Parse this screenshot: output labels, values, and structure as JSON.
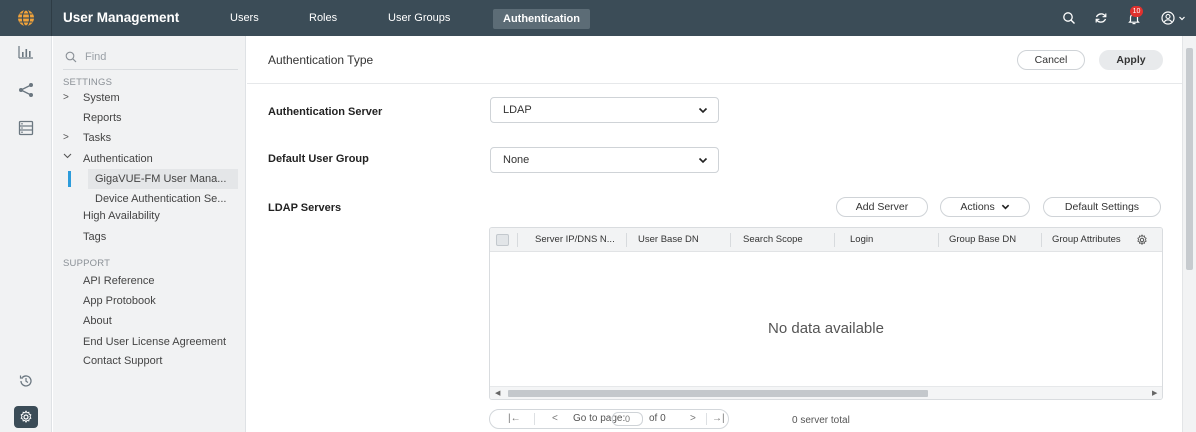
{
  "topbar": {
    "app_title": "User Management",
    "tabs": [
      {
        "label": "Users",
        "active": false
      },
      {
        "label": "Roles",
        "active": false
      },
      {
        "label": "User Groups",
        "active": false
      },
      {
        "label": "Authentication",
        "active": true
      }
    ],
    "notification_count": "10",
    "icons": [
      "globe-icon",
      "search-icon",
      "refresh-icon",
      "bell-icon",
      "user-icon"
    ]
  },
  "rail": {
    "icons": [
      "bar-chart-icon",
      "share-icon",
      "server-icon",
      "history-icon",
      "gear-icon"
    ]
  },
  "sidebar": {
    "search_placeholder": "Find",
    "settings_label": "SETTINGS",
    "support_label": "SUPPORT",
    "settings_items": [
      {
        "label": "System",
        "chevron": ">"
      },
      {
        "label": "Reports",
        "chevron": ""
      },
      {
        "label": "Tasks",
        "chevron": ">"
      },
      {
        "label": "Authentication",
        "chevron": "v"
      }
    ],
    "auth_children": [
      "GigaVUE-FM User Mana...",
      "Device Authentication Se..."
    ],
    "more_items": [
      "High Availability",
      "Tags"
    ],
    "support_items": [
      "API Reference",
      "App Protobook",
      "About",
      "End User License Agreement",
      "Contact Support"
    ]
  },
  "main": {
    "title": "Authentication Type",
    "cancel_label": "Cancel",
    "apply_label": "Apply",
    "auth_server_label": "Authentication Server",
    "auth_server_value": "LDAP",
    "default_group_label": "Default User Group",
    "default_group_value": "None",
    "ldap_label": "LDAP Servers",
    "add_server_label": "Add Server",
    "actions_label": "Actions",
    "default_settings_label": "Default Settings",
    "columns": [
      "Server IP/DNS N...",
      "User Base DN",
      "Search Scope",
      "Login",
      "Group Base DN",
      "Group Attributes"
    ],
    "empty_text": "No data available",
    "pager": {
      "first": "|←",
      "prev": "<",
      "goto_label": "Go to page:",
      "page": "0",
      "of_label": "of 0",
      "next": ">",
      "last": "→|"
    },
    "total_text": "0 server total"
  },
  "colors": {
    "topbar": "#3b4c57",
    "active_tab": "#5c6c76",
    "accent": "#2d9cdb",
    "badge": "#e0312e"
  }
}
